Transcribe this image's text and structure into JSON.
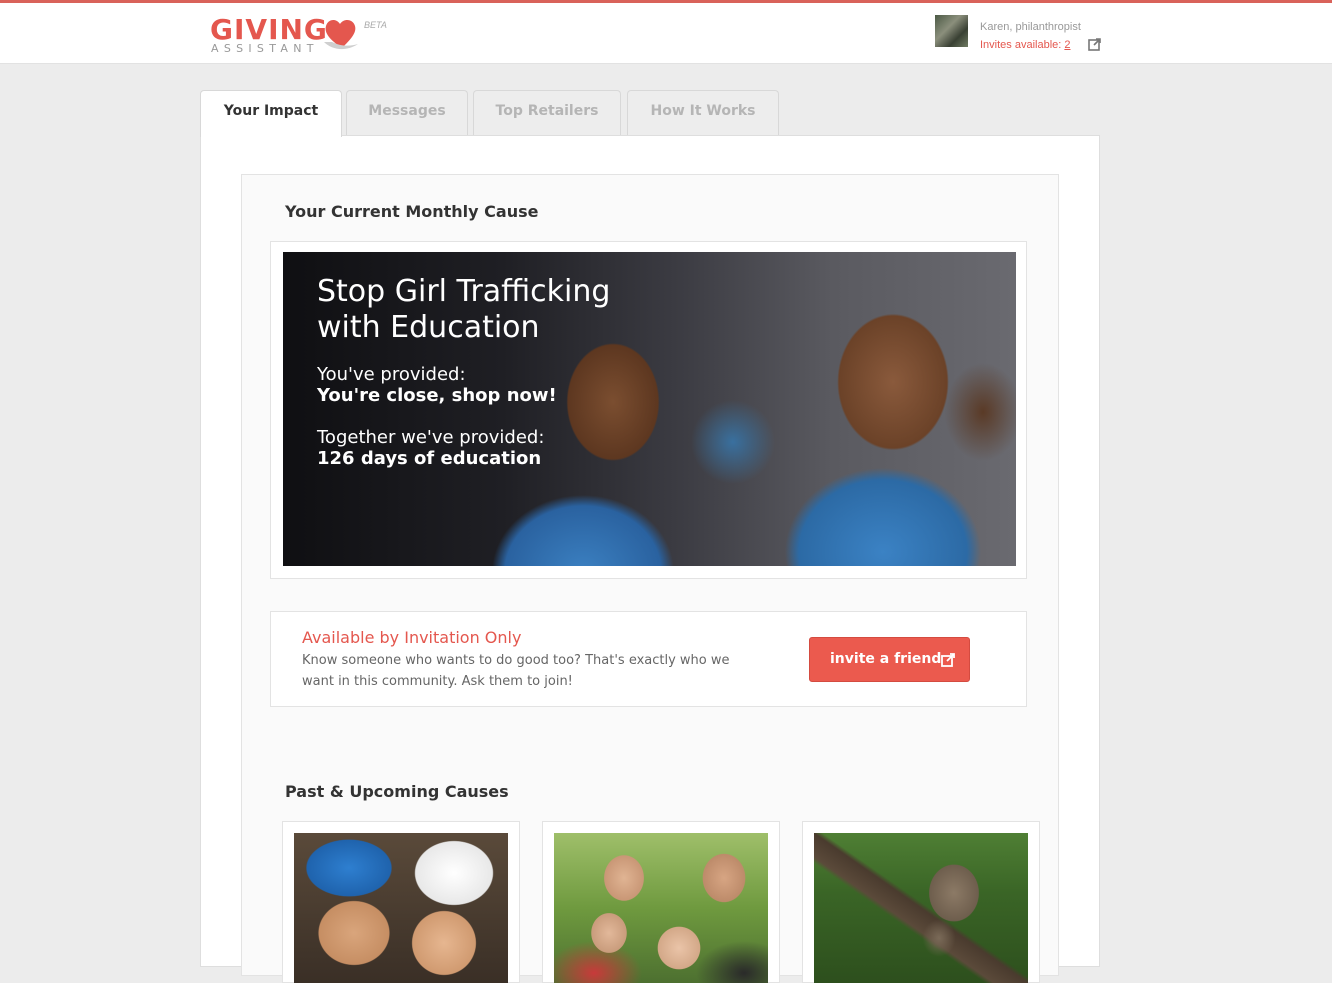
{
  "brand": {
    "logo_main": "GIVING",
    "logo_sub": "ASSISTANT",
    "badge": "BETA",
    "accent_color": "#e4574e"
  },
  "user": {
    "name": "Karen, philanthropist",
    "invites_label": "Invites available:",
    "invites_count": "2"
  },
  "tabs": [
    {
      "label": "Your Impact",
      "active": true
    },
    {
      "label": "Messages",
      "active": false
    },
    {
      "label": "Top Retailers",
      "active": false
    },
    {
      "label": "How It Works",
      "active": false
    }
  ],
  "current_cause": {
    "section_title": "Your Current Monthly Cause",
    "title": "Stop Girl Trafficking with Education",
    "provided_label": "You've provided:",
    "provided_value": "You're close, shop now!",
    "together_label": "Together we've provided:",
    "together_value": "126 days of education"
  },
  "invite": {
    "title": "Available by Invitation Only",
    "text": "Know someone who wants to do good too? That's exactly who we want in this community. Ask them to join!",
    "button_label": "invite a friend"
  },
  "past_causes": {
    "section_title": "Past & Upcoming Causes",
    "cards": [
      {
        "icon": "chefs-photo"
      },
      {
        "icon": "family-photo"
      },
      {
        "icon": "monkey-photo"
      }
    ]
  }
}
